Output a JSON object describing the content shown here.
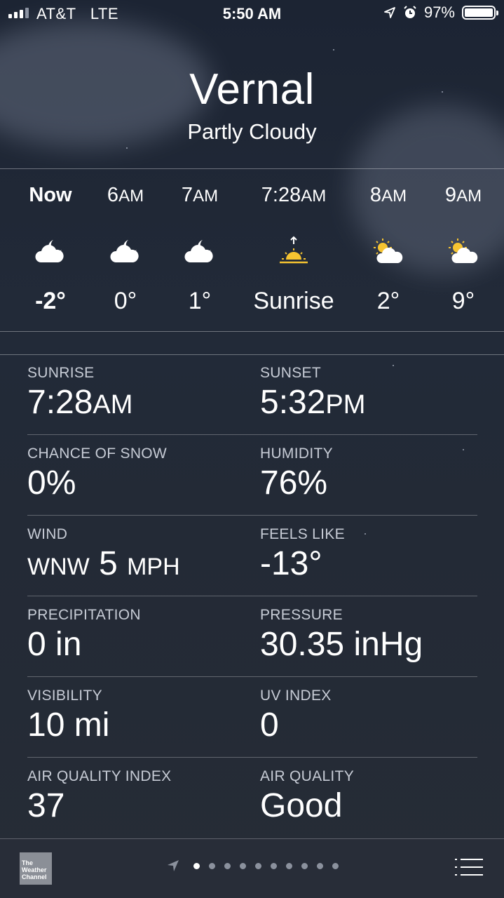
{
  "status": {
    "carrier": "AT&T",
    "network": "LTE",
    "time": "5:50 AM",
    "battery": "97%"
  },
  "header": {
    "city": "Vernal",
    "condition": "Partly Cloudy"
  },
  "hourly": [
    {
      "time": "Now",
      "icon": "partly-cloudy-night-icon",
      "value": "-2°"
    },
    {
      "time": "6",
      "suffix": "AM",
      "icon": "partly-cloudy-night-icon",
      "value": "0°"
    },
    {
      "time": "7",
      "suffix": "AM",
      "icon": "partly-cloudy-night-icon",
      "value": "1°"
    },
    {
      "time": "7:28",
      "suffix": "AM",
      "icon": "sunrise-icon",
      "value": "Sunrise"
    },
    {
      "time": "8",
      "suffix": "AM",
      "icon": "partly-sunny-icon",
      "value": "2°"
    },
    {
      "time": "9",
      "suffix": "AM",
      "icon": "partly-sunny-icon",
      "value": "9°"
    }
  ],
  "details": [
    {
      "label": "SUNRISE",
      "value": "7:28",
      "suffix": "AM"
    },
    {
      "label": "SUNSET",
      "value": "5:32",
      "suffix": "PM"
    },
    {
      "label": "CHANCE OF SNOW",
      "value": "0%"
    },
    {
      "label": "HUMIDITY",
      "value": "76%"
    },
    {
      "label": "WIND",
      "value": "wnw 5 mph"
    },
    {
      "label": "FEELS LIKE",
      "value": "-13°"
    },
    {
      "label": "PRECIPITATION",
      "value": "0 in"
    },
    {
      "label": "PRESSURE",
      "value": "30.35 inHg"
    },
    {
      "label": "VISIBILITY",
      "value": "10 mi"
    },
    {
      "label": "UV INDEX",
      "value": "0"
    },
    {
      "label": "AIR QUALITY INDEX",
      "value": "37"
    },
    {
      "label": "AIR QUALITY",
      "value": "Good"
    }
  ],
  "bottom": {
    "logo_text": "The Weather Channel",
    "page_count": 10,
    "active_page": 0
  },
  "colors": {
    "background": "#1f2735",
    "sun": "#f6c431",
    "cloud": "#ffffff",
    "bottom_bar": "#282d38"
  }
}
